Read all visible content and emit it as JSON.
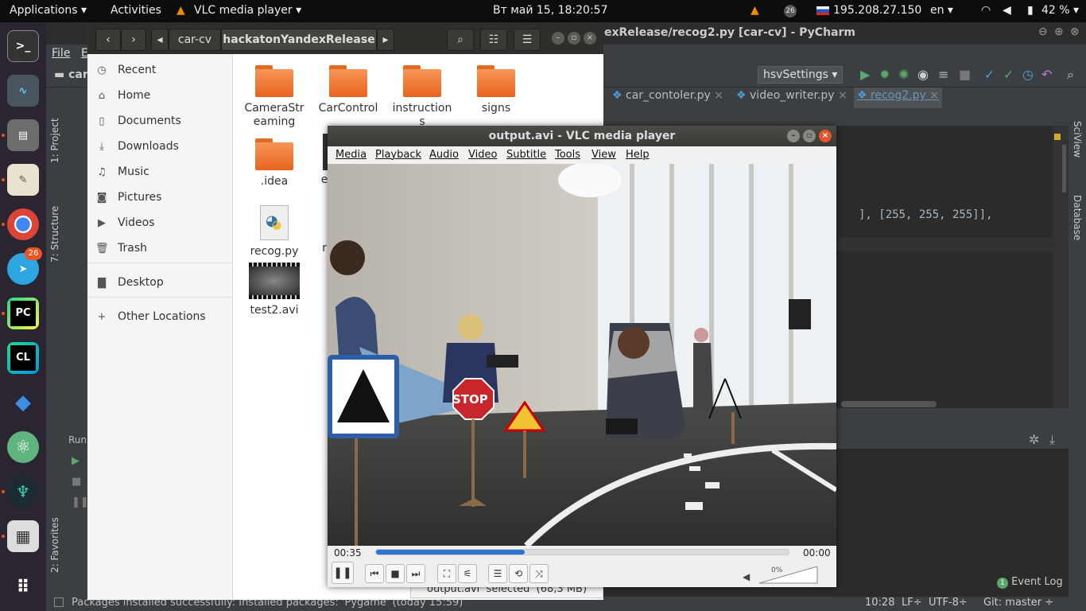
{
  "topbar": {
    "applications": "Applications ▾",
    "activities": "Activities",
    "focused_app": "VLC media player ▾",
    "clock": "Вт май 15, 18:20:57",
    "telegram_badge": "26",
    "ip": "195.208.27.150",
    "lang": "en ▾",
    "battery": "42 % ▾"
  },
  "dock": {
    "telegram_badge": "26",
    "items": [
      "terminal-icon",
      "system-monitor-icon",
      "files-icon",
      "text-editor-icon",
      "chrome-icon",
      "telegram-icon",
      "pycharm-icon",
      "clion-icon",
      "vscode-icon",
      "atom-icon",
      "gitkraken-icon",
      "calculator-icon",
      "app-grid-icon"
    ]
  },
  "pycharm": {
    "title": "exRelease/recog2.py [car-cv] - PyCharm",
    "menu_file": "File",
    "menu_edit": "E",
    "project_crumb": "car",
    "run_config": "hsvSettings ▾",
    "tabs": [
      "car_contoler.py",
      "video_writer.py",
      "recog2.py"
    ],
    "code_line": "], [255, 255, 255]],",
    "left_tabs": [
      "1: Project",
      "7: Structure",
      "2: Favorites"
    ],
    "right_tabs": [
      "SciView",
      "Database"
    ],
    "run_label": "Run",
    "event_log": "Event Log",
    "event_count": "1",
    "status_msg": "Packages installed successfully: Installed packages: 'Pygame' (today 15:59)",
    "status_pos": "10:28",
    "status_lf": "LF÷",
    "status_enc": "UTF-8÷",
    "status_git": "Git: master ÷"
  },
  "files": {
    "breadcrumb": [
      "car-cv",
      "hackatonYandexRelease"
    ],
    "sidebar": [
      {
        "icon": "clock-icon",
        "label": "Recent"
      },
      {
        "icon": "home-icon",
        "label": "Home"
      },
      {
        "icon": "document-icon",
        "label": "Documents"
      },
      {
        "icon": "download-icon",
        "label": "Downloads"
      },
      {
        "icon": "music-icon",
        "label": "Music"
      },
      {
        "icon": "camera-icon",
        "label": "Pictures"
      },
      {
        "icon": "video-icon",
        "label": "Videos"
      },
      {
        "icon": "trash-icon",
        "label": "Trash"
      },
      {
        "icon": "folder-icon",
        "label": "Desktop"
      },
      {
        "icon": "plus-icon",
        "label": "Other Locations"
      }
    ],
    "items": [
      {
        "name": "CameraStr\neaming",
        "type": "folder"
      },
      {
        "name": "CarControl",
        "type": "folder"
      },
      {
        "name": "instruction\ns",
        "type": "folder"
      },
      {
        "name": "signs",
        "type": "folder"
      },
      {
        "name": ".idea",
        "type": "folder"
      },
      {
        "name": "e",
        "type": "video"
      },
      {
        "name": "recog.py",
        "type": "python"
      },
      {
        "name": "r",
        "type": "python"
      },
      {
        "name": "test2.avi",
        "type": "video"
      }
    ],
    "status": "output.avi  selected  (68,3 MB)"
  },
  "vlc": {
    "title": "output.avi - VLC media player",
    "menu": [
      "Media",
      "Playback",
      "Audio",
      "Video",
      "Subtitle",
      "Tools",
      "View",
      "Help"
    ],
    "elapsed": "00:35",
    "remaining": "00:00",
    "progress": 0.36,
    "volume": "0%"
  }
}
